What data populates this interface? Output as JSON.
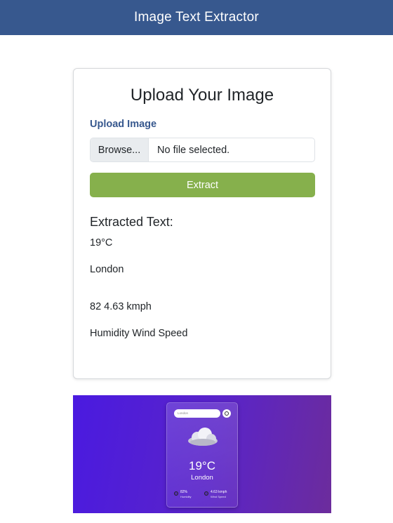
{
  "header": {
    "title": "Image Text Extractor"
  },
  "card": {
    "title": "Upload Your Image",
    "upload_label": "Upload Image",
    "file_input": {
      "button_label": "Browse...",
      "status": "No file selected."
    },
    "extract_label": "Extract",
    "extracted_heading": "Extracted Text:",
    "extracted_lines": [
      "19°C",
      "London",
      "82 4.63 kmph",
      "Humidity Wind Speed"
    ]
  },
  "preview": {
    "search_placeholder": "London",
    "temperature": "19°C",
    "city": "London",
    "humidity": {
      "value": "82%",
      "label": "Humidity",
      "icon": "humidity-icon"
    },
    "wind": {
      "value": "4.63 kmph",
      "label": "Wind Speed",
      "icon": "wind-icon"
    },
    "weather_icon": "cloud-icon"
  },
  "colors": {
    "header_bg": "#37588e",
    "accent_label": "#37588e",
    "extract_button": "#86b04c",
    "preview_gradient_start": "#4a1ae0",
    "preview_gradient_end": "#6c2c9c"
  }
}
